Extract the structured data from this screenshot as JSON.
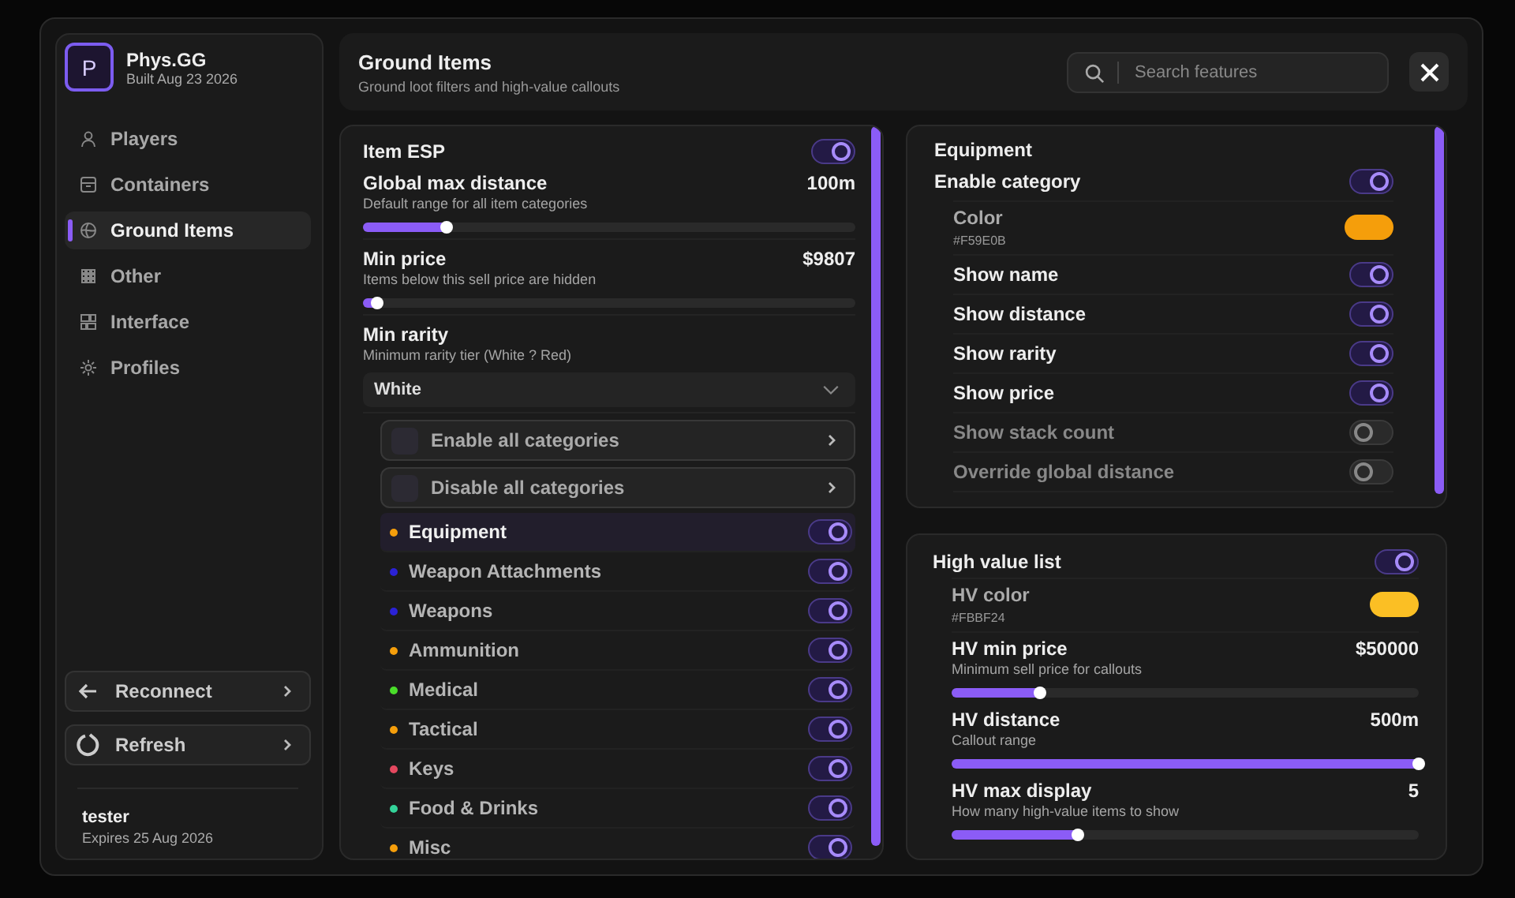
{
  "sidebar": {
    "brand": {
      "letter": "P",
      "name": "Phys.GG",
      "build": "Built Aug 23 2026"
    },
    "items": [
      {
        "label": "Players",
        "selected": false
      },
      {
        "label": "Containers",
        "selected": false
      },
      {
        "label": "Ground Items",
        "selected": true
      },
      {
        "label": "Other",
        "selected": false
      },
      {
        "label": "Interface",
        "selected": false
      },
      {
        "label": "Profiles",
        "selected": false
      }
    ],
    "buttons": [
      {
        "label": "Reconnect"
      },
      {
        "label": "Refresh"
      }
    ],
    "user": {
      "name": "tester",
      "expires": "Expires 25 Aug 2026"
    }
  },
  "header": {
    "title": "Ground Items",
    "subtitle": "Ground loot filters and high-value callouts",
    "search": {
      "placeholder": "Search features"
    }
  },
  "item_panel": {
    "item_esp": {
      "label": "Item ESP",
      "on": true
    },
    "sliders": [
      {
        "label": "Global max distance",
        "description": "Default range for all item categories",
        "value": "100m",
        "level": 0.17
      },
      {
        "label": "Min price",
        "description": "Items below this sell price are hidden",
        "value": "$9807",
        "level": 0.03
      }
    ],
    "rarity": {
      "label": "Min rarity",
      "description": "Minimum rarity tier (White ? Red)",
      "value": "White"
    },
    "actions": [
      {
        "label": "Enable all categories"
      },
      {
        "label": "Disable all categories"
      }
    ],
    "categories": [
      {
        "name": "Equipment",
        "color": "#f59e0b",
        "on": true,
        "selected": true
      },
      {
        "name": "Weapon Attachments",
        "color": "#2b22d6",
        "on": true,
        "selected": false
      },
      {
        "name": "Weapons",
        "color": "#2b22d6",
        "on": true,
        "selected": false
      },
      {
        "name": "Ammunition",
        "color": "#f59e0b",
        "on": true,
        "selected": false
      },
      {
        "name": "Medical",
        "color": "#4ade2a",
        "on": true,
        "selected": false
      },
      {
        "name": "Tactical",
        "color": "#f59e0b",
        "on": true,
        "selected": false
      },
      {
        "name": "Keys",
        "color": "#e5485f",
        "on": true,
        "selected": false
      },
      {
        "name": "Food & Drinks",
        "color": "#34d399",
        "on": true,
        "selected": false
      },
      {
        "name": "Misc",
        "color": "#f59e0b",
        "on": true,
        "selected": false
      }
    ]
  },
  "category_panel": {
    "title": "Equipment",
    "enable": {
      "label": "Enable category",
      "on": true
    },
    "color": {
      "label": "Color",
      "value": "#F59E0B",
      "color": "#f59e0b"
    },
    "options": [
      {
        "label": "Show name",
        "on": true
      },
      {
        "label": "Show distance",
        "on": true
      },
      {
        "label": "Show rarity",
        "on": true
      },
      {
        "label": "Show price",
        "on": true
      },
      {
        "label": "Show stack count",
        "on": false
      },
      {
        "label": "Override global distance",
        "on": false
      }
    ]
  },
  "hv_panel": {
    "label": "High value list",
    "on": true,
    "color": {
      "label": "HV color",
      "value": "#FBBF24",
      "color": "#fbbf24"
    },
    "sliders": [
      {
        "label": "HV min price",
        "description": "Minimum sell price for callouts",
        "value": "$50000",
        "level": 0.19
      },
      {
        "label": "HV distance",
        "description": "Callout range",
        "value": "500m",
        "level": 1
      },
      {
        "label": "HV max display",
        "description": "How many high-value items to show",
        "value": "5",
        "level": 0.27
      }
    ]
  }
}
